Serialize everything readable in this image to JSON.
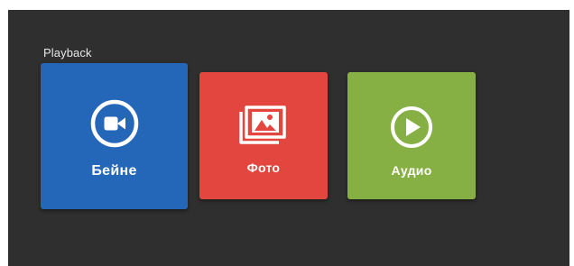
{
  "section": {
    "title": "Playback"
  },
  "tiles": [
    {
      "label": "Бейне",
      "icon": "video-camera-icon",
      "color": "#2466b8"
    },
    {
      "label": "Фото",
      "icon": "photo-gallery-icon",
      "color": "#e2463e"
    },
    {
      "label": "Аудио",
      "icon": "play-circle-icon",
      "color": "#86b043"
    }
  ],
  "colors": {
    "background": "#2f2f2f",
    "text": "#ffffff"
  }
}
